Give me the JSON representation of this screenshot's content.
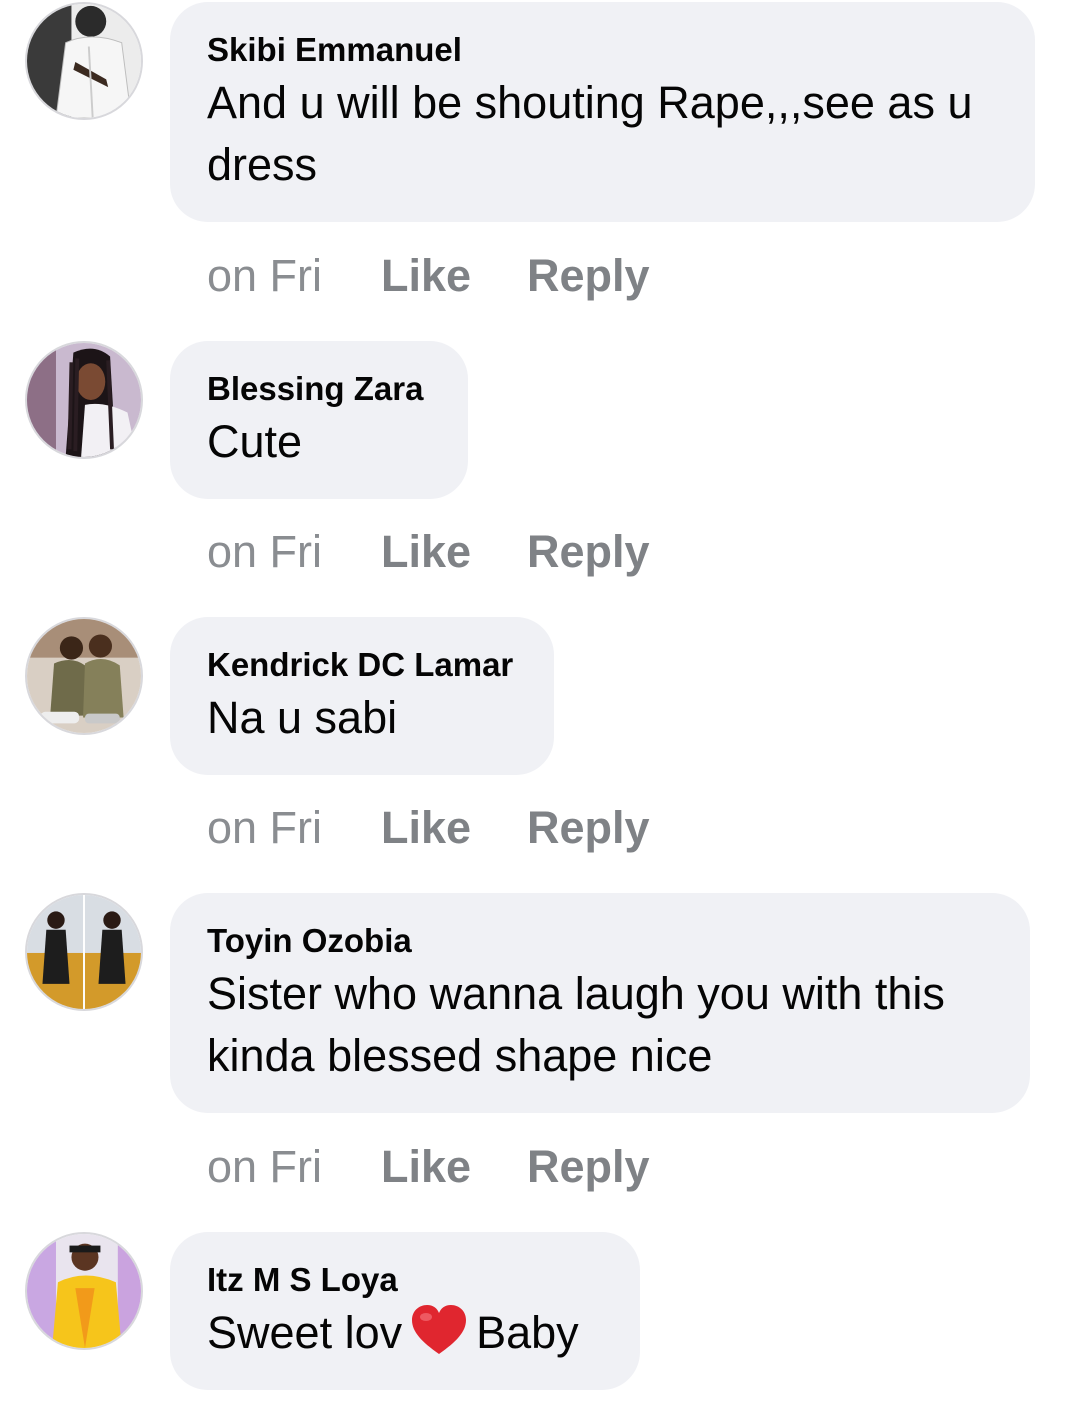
{
  "comments": [
    {
      "author": "Skibi Emmanuel",
      "text": "And u will be shouting Rape,,,see as u dress",
      "time": "on Fri",
      "like_label": "Like",
      "reply_label": "Reply"
    },
    {
      "author": "Blessing Zara",
      "text": "Cute",
      "time": "on Fri",
      "like_label": "Like",
      "reply_label": "Reply"
    },
    {
      "author": "Kendrick DC Lamar",
      "text": "Na u sabi",
      "time": "on Fri",
      "like_label": "Like",
      "reply_label": "Reply"
    },
    {
      "author": "Toyin Ozobia",
      "text": "Sister who wanna laugh you with this kinda blessed shape nice",
      "time": "on Fri",
      "like_label": "Like",
      "reply_label": "Reply"
    },
    {
      "author": "Itz M S Loya",
      "text_before": "Sweet lov",
      "emoji": "red-heart-emoji",
      "text_after": "Baby"
    }
  ],
  "colors": {
    "bubble": "#f0f1f5",
    "meta_text": "#8a8d91",
    "action_text": "#7f8286",
    "heart": "#e0262f"
  }
}
